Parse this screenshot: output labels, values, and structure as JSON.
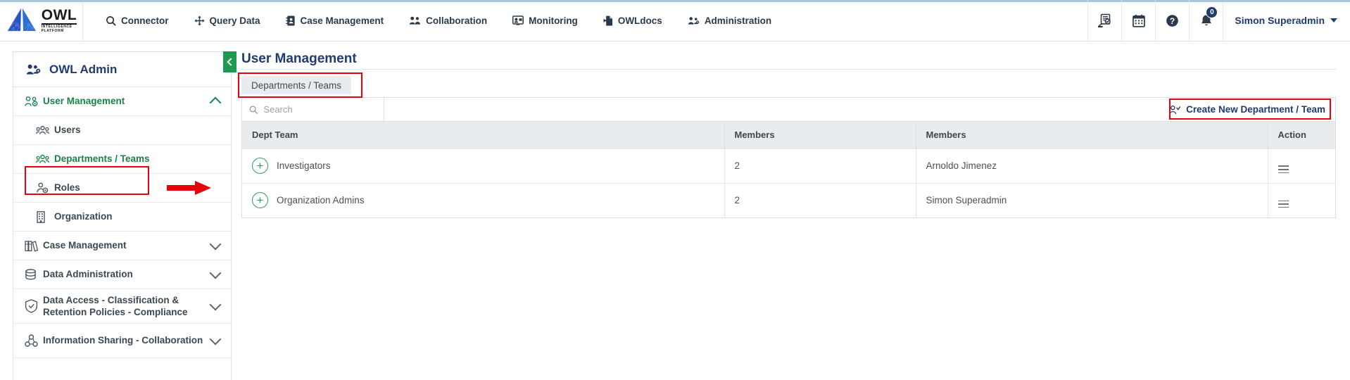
{
  "brand": {
    "name": "OWL",
    "tagline_line1": "INTELLIGENCE",
    "tagline_line2": "PLATFORM",
    "primary_blue": "#1f3b70",
    "accent_green": "#1a8348",
    "highlight_red": "#e8000d"
  },
  "topnav": {
    "items": [
      {
        "label": "Connector",
        "icon": "search-icon"
      },
      {
        "label": "Query Data",
        "icon": "move-arrows-icon"
      },
      {
        "label": "Case Management",
        "icon": "contact-book-icon"
      },
      {
        "label": "Collaboration",
        "icon": "people-icon"
      },
      {
        "label": "Monitoring",
        "icon": "monitor-person-icon"
      },
      {
        "label": "OWLdocs",
        "icon": "document-arrow-icon"
      },
      {
        "label": "Administration",
        "icon": "admin-people-gear-icon"
      }
    ],
    "right_icons": [
      {
        "name": "report-document-icon"
      },
      {
        "name": "calendar-icon"
      },
      {
        "name": "help-question-icon"
      },
      {
        "name": "notification-bell-icon"
      }
    ],
    "notification_count": "0",
    "user_name": "Simon Superadmin"
  },
  "sidebar": {
    "title": "OWL Admin",
    "title_icon": "people-gear-icon",
    "items": [
      {
        "label": "User Management",
        "icon": "user-gear-icon",
        "state": "expanded",
        "chevron": "up",
        "active": true
      },
      {
        "label": "Users",
        "icon": "users-group-icon",
        "sub": true,
        "active": false
      },
      {
        "label": "Departments / Teams",
        "icon": "teams-icon",
        "sub": true,
        "active": true,
        "highlighted": true
      },
      {
        "label": "Roles",
        "icon": "person-gear-icon",
        "sub": true,
        "active": false
      },
      {
        "label": "Organization",
        "icon": "building-icon",
        "sub": true,
        "active": false
      },
      {
        "label": "Case Management",
        "icon": "books-icon",
        "chevron": "down",
        "active": false
      },
      {
        "label": "Data Administration",
        "icon": "database-icon",
        "chevron": "down",
        "active": false
      },
      {
        "label": "Data Access - Classification & Retention Policies - Compliance",
        "icon": "shield-check-icon",
        "chevron": "down",
        "active": false,
        "two_line": true
      },
      {
        "label": "Information Sharing - Collaboration",
        "icon": "share-nodes-icon",
        "chevron": "down",
        "active": false,
        "two_line": true
      }
    ]
  },
  "main": {
    "title": "User Management",
    "collapse_icon": "chevron-left-icon",
    "tabs": [
      {
        "label": "Departments / Teams",
        "active": true,
        "highlighted": true
      }
    ],
    "search": {
      "placeholder": "Search",
      "value": "",
      "icon": "search-icon"
    },
    "create_button": {
      "label": "Create New Department / Team",
      "icon": "add-user-icon",
      "highlighted": true
    },
    "table": {
      "columns": [
        "Dept Team",
        "Members",
        "Members",
        "Action"
      ],
      "rows": [
        {
          "dept_team": "Investigators",
          "expand_icon": "plus-circle-icon",
          "member_count": "2",
          "members": "Arnoldo Jimenez",
          "action_icon": "hamburger-menu-icon"
        },
        {
          "dept_team": "Organization Admins",
          "expand_icon": "plus-circle-icon",
          "member_count": "2",
          "members": "Simon Superadmin",
          "action_icon": "hamburger-menu-icon"
        }
      ]
    }
  },
  "annotations": {
    "arrow_icon": "red-arrow-right"
  }
}
